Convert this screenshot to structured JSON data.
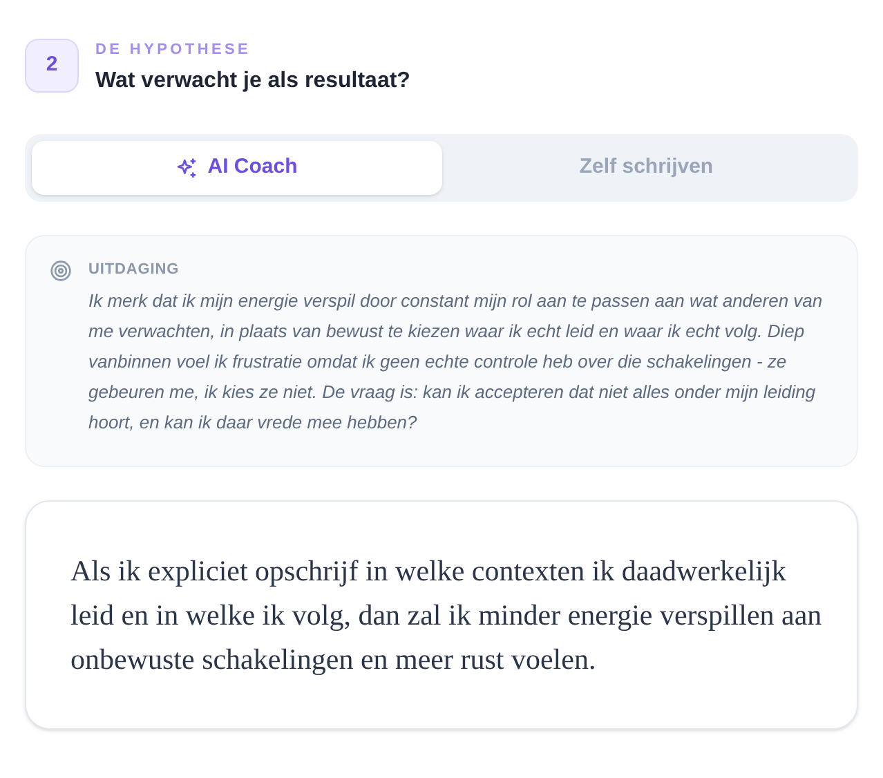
{
  "step": {
    "number": "2",
    "eyebrow": "DE HYPOTHESE",
    "question": "Wat verwacht je als resultaat?"
  },
  "tabs": [
    {
      "label": "AI Coach",
      "kind": "ai",
      "selected": true
    },
    {
      "label": "Zelf schrijven",
      "kind": "plain",
      "selected": false
    }
  ],
  "challenge": {
    "label": "UITDAGING",
    "text": "Ik merk dat ik mijn energie verspil door constant mijn rol aan te passen aan wat anderen van me verwachten, in plaats van bewust te kiezen waar ik echt leid en waar ik echt volg. Diep vanbinnen voel ik frustratie omdat ik geen echte controle heb over die schakelingen - ze gebeuren me, ik kies ze niet. De vraag is: kan ik accepteren dat niet alles onder mijn leiding hoort, en kan ik daar vrede mee hebben?"
  },
  "answer": {
    "text": "Als ik expliciet opschrijf in welke contexten ik daadwerkelijk leid en in welke ik volg, dan zal ik minder energie verspillen aan onbewuste schakelingen en meer rust voelen."
  }
}
